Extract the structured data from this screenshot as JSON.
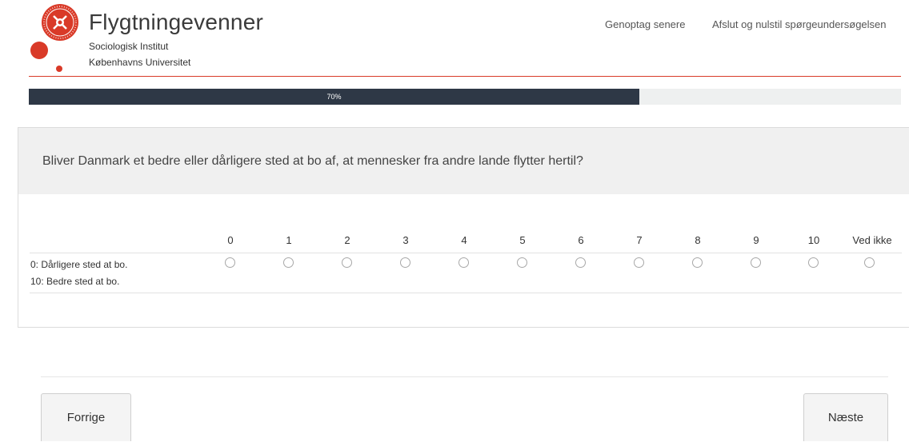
{
  "header": {
    "brand_title": "Flygtningevenner",
    "brand_subtitle1": "Sociologisk Institut",
    "brand_subtitle2": "Københavns Universitet",
    "nav_resume": "Genoptag senere",
    "nav_end": "Afslut og nulstil spørgeundersøgelsen",
    "brand_color": "#d93a28"
  },
  "progress": {
    "percent": 70,
    "label": "70%"
  },
  "question": {
    "text": "Bliver Danmark et bedre eller dårligere sted at bo af, at mennesker fra andre lande flytter hertil?",
    "scale": [
      "0",
      "1",
      "2",
      "3",
      "4",
      "5",
      "6",
      "7",
      "8",
      "9",
      "10",
      "Ved ikke"
    ],
    "row_label_line1": "0: Dårligere sted at bo.",
    "row_label_line2": "10: Bedre sted at bo."
  },
  "footer": {
    "prev_label": "Forrige",
    "next_label": "Næste"
  }
}
